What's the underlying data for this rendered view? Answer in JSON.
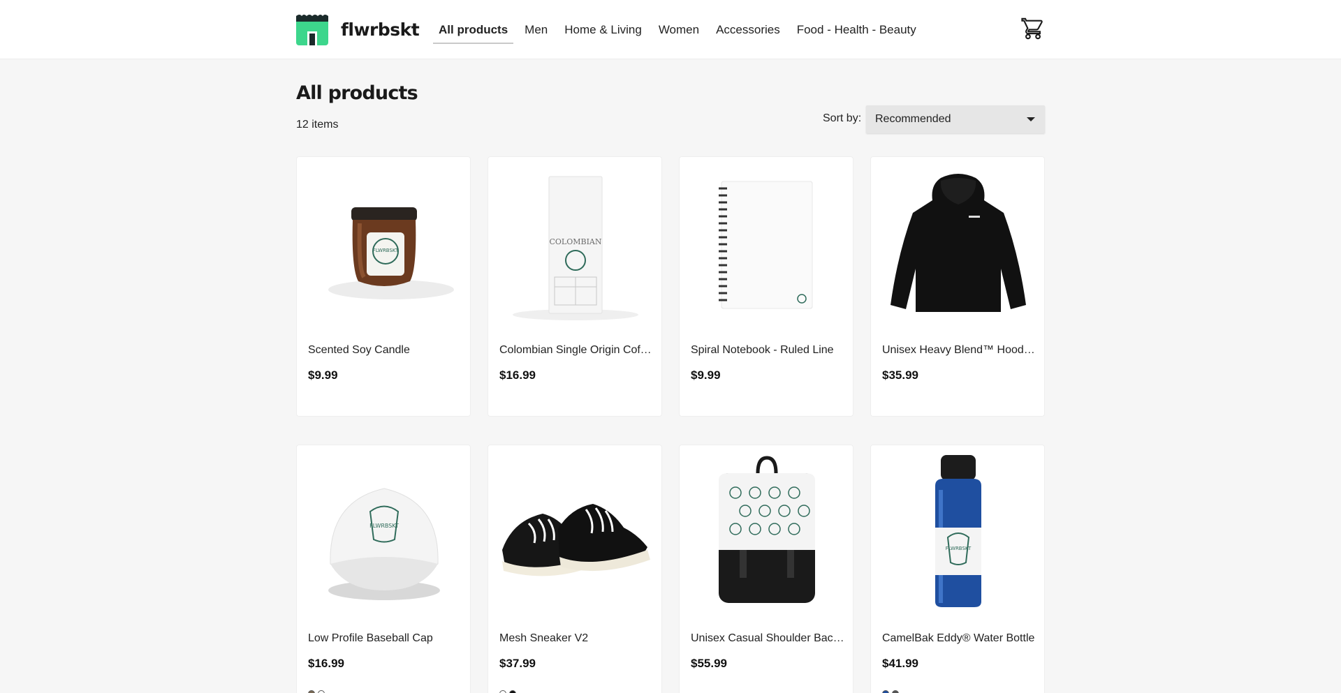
{
  "brand": {
    "name": "flwrbskt",
    "logo_colors": {
      "awning": "#3dd68c",
      "frame": "#1b2b2b"
    }
  },
  "nav": {
    "items": [
      {
        "label": "All products",
        "active": true
      },
      {
        "label": "Men",
        "active": false
      },
      {
        "label": "Home & Living",
        "active": false
      },
      {
        "label": "Women",
        "active": false
      },
      {
        "label": "Accessories",
        "active": false
      },
      {
        "label": "Food - Health - Beauty",
        "active": false
      }
    ],
    "cart_icon": "shopping-cart-icon"
  },
  "page": {
    "title": "All products",
    "item_count": "12 items",
    "sort": {
      "label": "Sort by:",
      "value": "Recommended"
    }
  },
  "products": [
    {
      "name": "Scented Soy Candle",
      "price": "$9.99",
      "image": "candle",
      "swatches": []
    },
    {
      "name": "Colombian Single Origin Coffee",
      "price": "$16.99",
      "image": "coffee-bag",
      "image_text": "COLOMBIAN",
      "swatches": []
    },
    {
      "name": "Spiral Notebook - Ruled Line",
      "price": "$9.99",
      "image": "notebook",
      "swatches": []
    },
    {
      "name": "Unisex Heavy Blend™ Hooded Sweatshirt",
      "price": "$35.99",
      "image": "hoodie",
      "swatches": []
    },
    {
      "name": "Low Profile Baseball Cap",
      "price": "$16.99",
      "image": "cap",
      "swatches": [
        "#7a6a55",
        "#ffffff"
      ]
    },
    {
      "name": "Mesh Sneaker V2",
      "price": "$37.99",
      "image": "sneakers",
      "swatches": [
        "#ffffff",
        "#111111"
      ]
    },
    {
      "name": "Unisex Casual Shoulder Backpack",
      "price": "$55.99",
      "image": "backpack",
      "swatches": []
    },
    {
      "name": "CamelBak Eddy® Water Bottle",
      "price": "$41.99",
      "image": "water-bottle",
      "swatches": [
        "#1f4fa0",
        "#555555"
      ]
    }
  ],
  "colors": {
    "background": "#f6f6f6",
    "card": "#ffffff",
    "sort_bg": "#e6e6e6",
    "brand_green": "#3dd68c",
    "print_green": "#2f6b5a"
  }
}
